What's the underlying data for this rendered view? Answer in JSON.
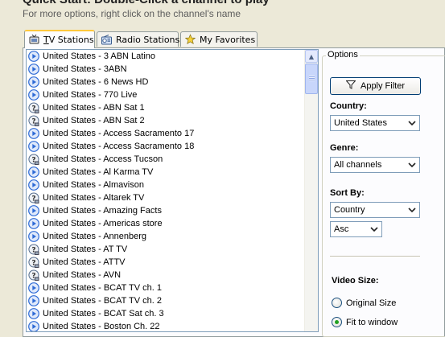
{
  "header": {
    "title": "Quick Start: Double-Click a channel to play",
    "subtitle": "For more options, right click on the channel's name"
  },
  "tabs": [
    {
      "label": "TV Stations",
      "icon": "tv-icon",
      "active": true
    },
    {
      "label": "Radio Stations",
      "icon": "radio-icon",
      "active": false
    },
    {
      "label": "My Favorites",
      "icon": "star-icon",
      "active": false
    }
  ],
  "channels": [
    {
      "name": "United States - 3 ABN Latino",
      "icon": "stream-play-icon"
    },
    {
      "name": "United States - 3ABN",
      "icon": "stream-play-icon"
    },
    {
      "name": "United States - 6 News HD",
      "icon": "stream-play-icon"
    },
    {
      "name": "United States - 770 Live",
      "icon": "stream-play-icon"
    },
    {
      "name": "United States - ABN Sat 1",
      "icon": "stream-unknown-icon"
    },
    {
      "name": "United States - ABN Sat 2",
      "icon": "stream-unknown-icon"
    },
    {
      "name": "United States - Access Sacramento 17",
      "icon": "stream-play-icon"
    },
    {
      "name": "United States - Access Sacramento 18",
      "icon": "stream-play-icon"
    },
    {
      "name": "United States - Access Tucson",
      "icon": "stream-unknown-icon"
    },
    {
      "name": "United States - Al Karma TV",
      "icon": "stream-play-icon"
    },
    {
      "name": "United States - Almavison",
      "icon": "stream-play-icon"
    },
    {
      "name": "United States - Altarek TV",
      "icon": "stream-unknown-icon"
    },
    {
      "name": "United States - Amazing Facts",
      "icon": "stream-play-icon"
    },
    {
      "name": "United States - Americas store",
      "icon": "stream-play-icon"
    },
    {
      "name": "United States - Annenberg",
      "icon": "stream-play-icon"
    },
    {
      "name": "United States - AT TV",
      "icon": "stream-unknown-icon"
    },
    {
      "name": "United States - ATTV",
      "icon": "stream-unknown-icon"
    },
    {
      "name": "United States - AVN",
      "icon": "stream-unknown-icon"
    },
    {
      "name": "United States - BCAT TV ch. 1",
      "icon": "stream-play-icon"
    },
    {
      "name": "United States - BCAT TV ch. 2",
      "icon": "stream-play-icon"
    },
    {
      "name": "United States - BCAT Sat ch. 3",
      "icon": "stream-play-icon"
    },
    {
      "name": "United States - Boston Ch. 22",
      "icon": "stream-play-icon"
    }
  ],
  "options": {
    "legend": "Options",
    "apply_filter": "Apply Filter",
    "country_label": "Country:",
    "country_value": "United States",
    "genre_label": "Genre:",
    "genre_value": "All channels",
    "sort_label": "Sort By:",
    "sort_value": "Country",
    "order_value": "Asc",
    "video_size_label": "Video Size:",
    "video_sizes": [
      {
        "label": "Original Size",
        "selected": false
      },
      {
        "label": "Fit to window",
        "selected": true
      }
    ]
  },
  "colors": {
    "window_bg": "#ece9d8",
    "active_tab_highlight": "#ffc83c",
    "list_border": "#7f9db9",
    "play_icon_blue": "#2f6bd6",
    "radio_selected": "#21a121"
  }
}
